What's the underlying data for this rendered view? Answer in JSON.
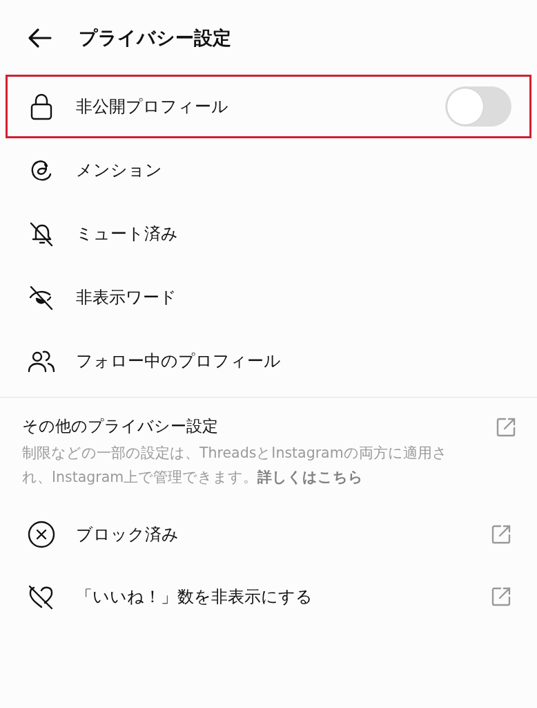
{
  "header": {
    "title": "プライバシー設定"
  },
  "rows": [
    {
      "label": "非公開プロフィール",
      "kind": "toggle",
      "on": false,
      "highlighted": true
    },
    {
      "label": "メンション",
      "kind": "plain",
      "highlighted": false
    },
    {
      "label": "ミュート済み",
      "kind": "plain",
      "highlighted": false
    },
    {
      "label": "非表示ワード",
      "kind": "plain",
      "highlighted": false
    },
    {
      "label": "フォロー中のプロフィール",
      "kind": "plain",
      "highlighted": false
    }
  ],
  "other_section": {
    "title": "その他のプライバシー設定",
    "description": "制限などの一部の設定は、ThreadsとInstagramの両方に適用され、Instagram上で管理できます。",
    "link": "詳しくはこちら"
  },
  "external_rows": [
    {
      "label": "ブロック済み",
      "kind": "external"
    },
    {
      "label": "「いいね！」数を非表示にする",
      "kind": "external"
    }
  ]
}
